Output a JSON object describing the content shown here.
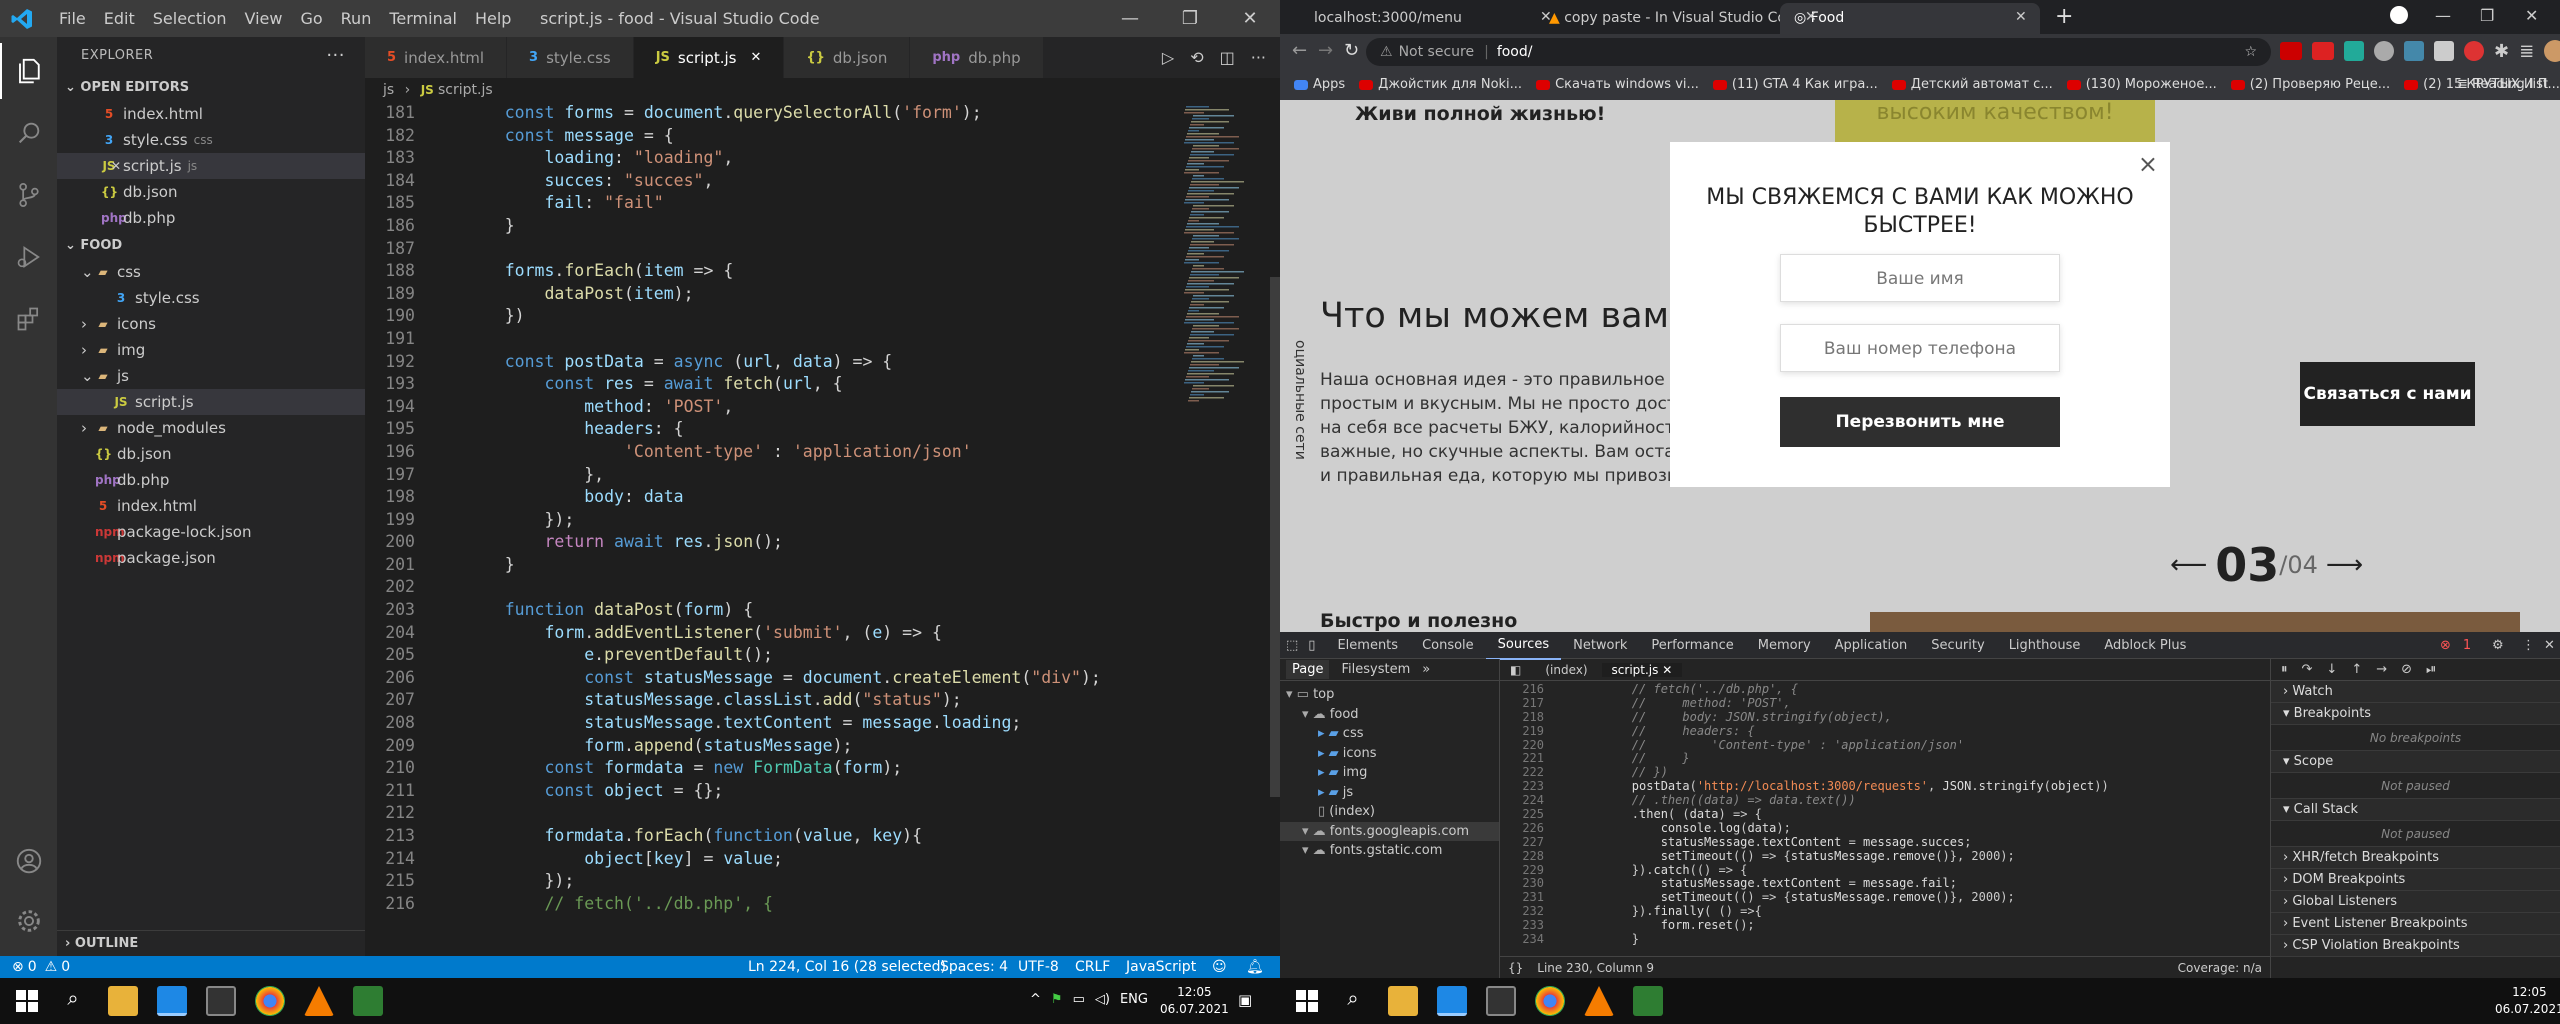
{
  "vscode": {
    "menu": [
      "File",
      "Edit",
      "Selection",
      "View",
      "Go",
      "Run",
      "Terminal",
      "Help"
    ],
    "window_title": "script.js - food - Visual Studio Code",
    "explorer_title": "EXPLORER",
    "open_editors_title": "OPEN EDITORS",
    "open_editors": [
      {
        "name": "index.html",
        "icon": "html-icon",
        "color": "#e44d26",
        "hint": ""
      },
      {
        "name": "style.css",
        "icon": "css-icon",
        "color": "#42a5f5",
        "hint": "css"
      },
      {
        "name": "script.js",
        "icon": "js-icon",
        "color": "#cbcb41",
        "hint": "js"
      },
      {
        "name": "db.json",
        "icon": "json-icon",
        "color": "#cbcb41",
        "hint": ""
      },
      {
        "name": "db.php",
        "icon": "php-icon",
        "color": "#a074c4",
        "hint": ""
      }
    ],
    "folder_title": "FOOD",
    "tree": [
      {
        "name": "css",
        "type": "folder",
        "open": true,
        "indent": 1
      },
      {
        "name": "style.css",
        "type": "css",
        "indent": 2
      },
      {
        "name": "icons",
        "type": "folder",
        "open": false,
        "indent": 1
      },
      {
        "name": "img",
        "type": "folder",
        "open": false,
        "indent": 1
      },
      {
        "name": "js",
        "type": "folder",
        "open": true,
        "indent": 1
      },
      {
        "name": "script.js",
        "type": "js",
        "indent": 2
      },
      {
        "name": "node_modules",
        "type": "folder",
        "open": false,
        "indent": 1
      },
      {
        "name": "db.json",
        "type": "json",
        "indent": 1
      },
      {
        "name": "db.php",
        "type": "php",
        "indent": 1
      },
      {
        "name": "index.html",
        "type": "html",
        "indent": 1
      },
      {
        "name": "package-lock.json",
        "type": "npm",
        "indent": 1
      },
      {
        "name": "package.json",
        "type": "npm",
        "indent": 1
      }
    ],
    "outline_title": "OUTLINE",
    "tabs": [
      {
        "name": "index.html",
        "icon": "html-icon",
        "color": "#e44d26"
      },
      {
        "name": "style.css",
        "icon": "css-icon",
        "color": "#42a5f5"
      },
      {
        "name": "script.js",
        "icon": "js-icon",
        "color": "#cbcb41",
        "active": true
      },
      {
        "name": "db.json",
        "icon": "json-icon",
        "color": "#cbcb41"
      },
      {
        "name": "db.php",
        "icon": "php-icon",
        "color": "#a074c4"
      }
    ],
    "breadcrumb": [
      "js",
      "script.js"
    ],
    "code_start": 181,
    "code": [
      "    const forms = document.querySelectorAll('form');",
      "    const message = {",
      "        loading: \"loading\",",
      "        succes: \"succes\",",
      "        fail: \"fail\"",
      "    }",
      "",
      "    forms.forEach(item => {",
      "        dataPost(item);",
      "    })",
      "",
      "    const postData = async (url, data) => {",
      "        const res = await fetch(url, {",
      "            method: 'POST',",
      "            headers: {",
      "                'Content-type' : 'application/json'",
      "            },",
      "            body: data",
      "        });",
      "        return await res.json();",
      "    }",
      "",
      "    function dataPost(form) {",
      "        form.addEventListener('submit', (e) => {",
      "            e.preventDefault();",
      "            const statusMessage = document.createElement(\"div\");",
      "            statusMessage.classList.add(\"status\");",
      "            statusMessage.textContent = message.loading;",
      "            form.append(statusMessage);",
      "        const formdata = new FormData(form);",
      "        const object = {};",
      "",
      "        formdata.forEach(function(value, key){",
      "            object[key] = value;",
      "        });",
      "        // fetch('../db.php', {"
    ],
    "status": {
      "errors": "0",
      "warnings": "0",
      "position": "Ln 224, Col 16 (28 selected)",
      "spaces": "Spaces: 4",
      "encoding": "UTF-8",
      "eol": "CRLF",
      "language": "JavaScript"
    }
  },
  "chrome": {
    "tabs": [
      "localhost:3000/menu",
      "copy paste - In Visual Studio Co",
      "Food"
    ],
    "active_tab": 2,
    "omnibox": {
      "secure_label": "Not secure",
      "url": "food/"
    },
    "bookmarks": [
      "Apps",
      "Джойстик для Noki...",
      "Скачать windows vi...",
      "(11) GTA 4 Как игра...",
      "Детский автомат с...",
      "(130) Мороженое...",
      "(2) Проверяю Реце...",
      "(2) 15 КРУТЫХ И П..."
    ],
    "reading_list": "Reading list",
    "page": {
      "top_text": "Живи полной жизнью!",
      "banner_text": "высоким качеством!",
      "heading": "Что мы можем вам п",
      "side_label": "оциальные сети",
      "paragraph": [
        "Наша основная идея - это правильное пит",
        "простым и вкусным. Мы не просто достав",
        "на себя все расчеты БЖУ, калорийности, с",
        "важные, но скучные аспекты. Вам остаетс",
        "и правильная еда, которую мы привозим"
      ],
      "contact_button": "Связаться с нами",
      "slider_current": "03",
      "slider_total": "/04",
      "bottom_text": "Быстро и полезно"
    },
    "modal": {
      "title": "МЫ СВЯЖЕМСЯ С ВАМИ КАК МОЖНО БЫСТРЕЕ!",
      "name_placeholder": "Ваше имя",
      "phone_placeholder": "Ваш номер телефона",
      "button": "Перезвонить мне",
      "close": "×"
    },
    "devtools": {
      "tabs": [
        "Elements",
        "Console",
        "Sources",
        "Network",
        "Performance",
        "Memory",
        "Application",
        "Security",
        "Lighthouse",
        "Adblock Plus"
      ],
      "active_tab": 2,
      "error_count": "1",
      "left_tabs": [
        "Page",
        "Filesystem"
      ],
      "tree": [
        {
          "name": "top",
          "indent": 0
        },
        {
          "name": "food",
          "indent": 1
        },
        {
          "name": "css",
          "indent": 2
        },
        {
          "name": "icons",
          "indent": 2
        },
        {
          "name": "img",
          "indent": 2
        },
        {
          "name": "js",
          "indent": 2
        },
        {
          "name": "(index)",
          "indent": 2
        },
        {
          "name": "fonts.googleapis.com",
          "indent": 1
        },
        {
          "name": "fonts.gstatic.com",
          "indent": 1
        }
      ],
      "file_tabs": [
        "(index)",
        "script.js"
      ],
      "source_start": 216,
      "source": [
        "        // fetch('../db.php', {",
        "        //     method: 'POST',",
        "        //     body: JSON.stringify(object),",
        "        //     headers: {",
        "        //         'Content-type' : 'application/json'",
        "        //     }",
        "        // })",
        "        postData('http://localhost:3000/requests', JSON.stringify(object))",
        "        // .then((data) => data.text())",
        "        .then( (data) => {",
        "            console.log(data);",
        "            statusMessage.textContent = message.succes;",
        "            setTimeout(() => {statusMessage.remove()}, 2000);",
        "        }).catch(() => {",
        "            statusMessage.textContent = message.fail;",
        "            setTimeout(() => {statusMessage.remove()}, 2000);",
        "        }).finally( () =>{",
        "            form.reset();",
        "        }"
      ],
      "footer_position": "Line 230, Column 9",
      "coverage": "Coverage: n/a",
      "right_panes": [
        {
          "title": "Watch",
          "body": ""
        },
        {
          "title": "Breakpoints",
          "body": "No breakpoints"
        },
        {
          "title": "Scope",
          "body": "Not paused"
        },
        {
          "title": "Call Stack",
          "body": "Not paused"
        },
        {
          "title": "XHR/fetch Breakpoints",
          "body": ""
        },
        {
          "title": "DOM Breakpoints",
          "body": ""
        },
        {
          "title": "Global Listeners",
          "body": ""
        },
        {
          "title": "Event Listener Breakpoints",
          "body": ""
        },
        {
          "title": "CSP Violation Breakpoints",
          "body": ""
        }
      ]
    }
  },
  "taskbar": {
    "left": {
      "time": "12:05",
      "date": "06.07.2021",
      "lang": "ENG"
    },
    "right": {
      "time": "12:05",
      "date": "06.07.2021"
    }
  }
}
